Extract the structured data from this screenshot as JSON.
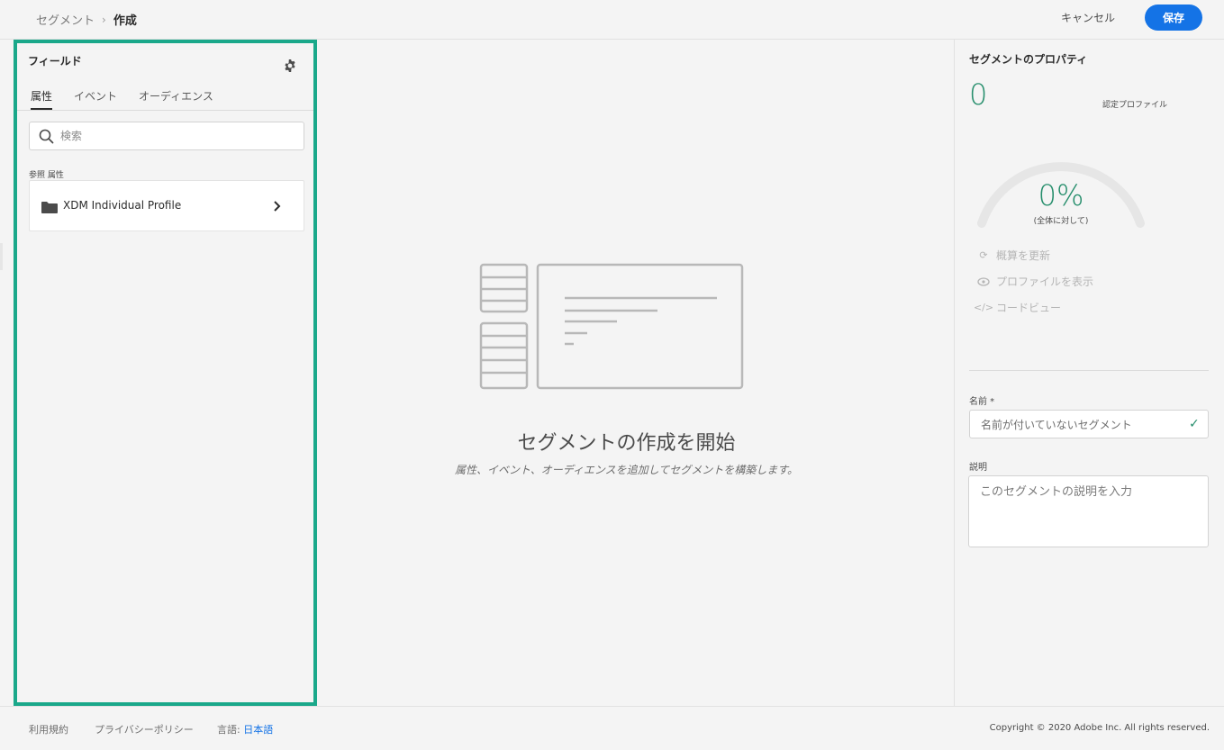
{
  "header": {
    "breadcrumb_parent": "セグメント",
    "breadcrumb_current": "作成",
    "cancel_label": "キャンセル",
    "save_label": "保存"
  },
  "fields_panel": {
    "title": "フィールド",
    "tabs": [
      {
        "label": "属性",
        "active": true
      },
      {
        "label": "イベント",
        "active": false
      },
      {
        "label": "オーディエンス",
        "active": false
      }
    ],
    "search_placeholder": "検索",
    "section_label": "参照 属性",
    "items": [
      {
        "label": "XDM Individual Profile",
        "icon": "folder-icon"
      }
    ],
    "highlight_color": "#1aa88a"
  },
  "canvas": {
    "title": "セグメントの作成を開始",
    "subtitle": "属性、イベント、オーディエンスを追加してセグメントを構築します。"
  },
  "properties": {
    "title": "セグメントのプロパティ",
    "count": "0",
    "count_label": "認定プロファイル",
    "percent": "0%",
    "percent_label": "(全体に対して)",
    "gauge_fraction": 0,
    "actions": [
      {
        "label": "概算を更新",
        "icon": "refresh-icon"
      },
      {
        "label": "プロファイルを表示",
        "icon": "eye-icon"
      },
      {
        "label": "コードビュー",
        "icon": "code-icon"
      }
    ],
    "name_label": "名前 *",
    "name_placeholder": "名前が付いていないセグメント",
    "description_label": "説明",
    "description_placeholder": "このセグメントの説明を入力",
    "accent_color": "#268e6c"
  },
  "footer": {
    "terms": "利用規約",
    "privacy": "プライバシーポリシー",
    "language_label": "言語:",
    "language_value": "日本語",
    "copyright": "Copyright ©  2020 Adobe Inc.  All rights reserved."
  },
  "colors": {
    "primary_button": "#1473e6",
    "background": "#f4f4f4"
  }
}
